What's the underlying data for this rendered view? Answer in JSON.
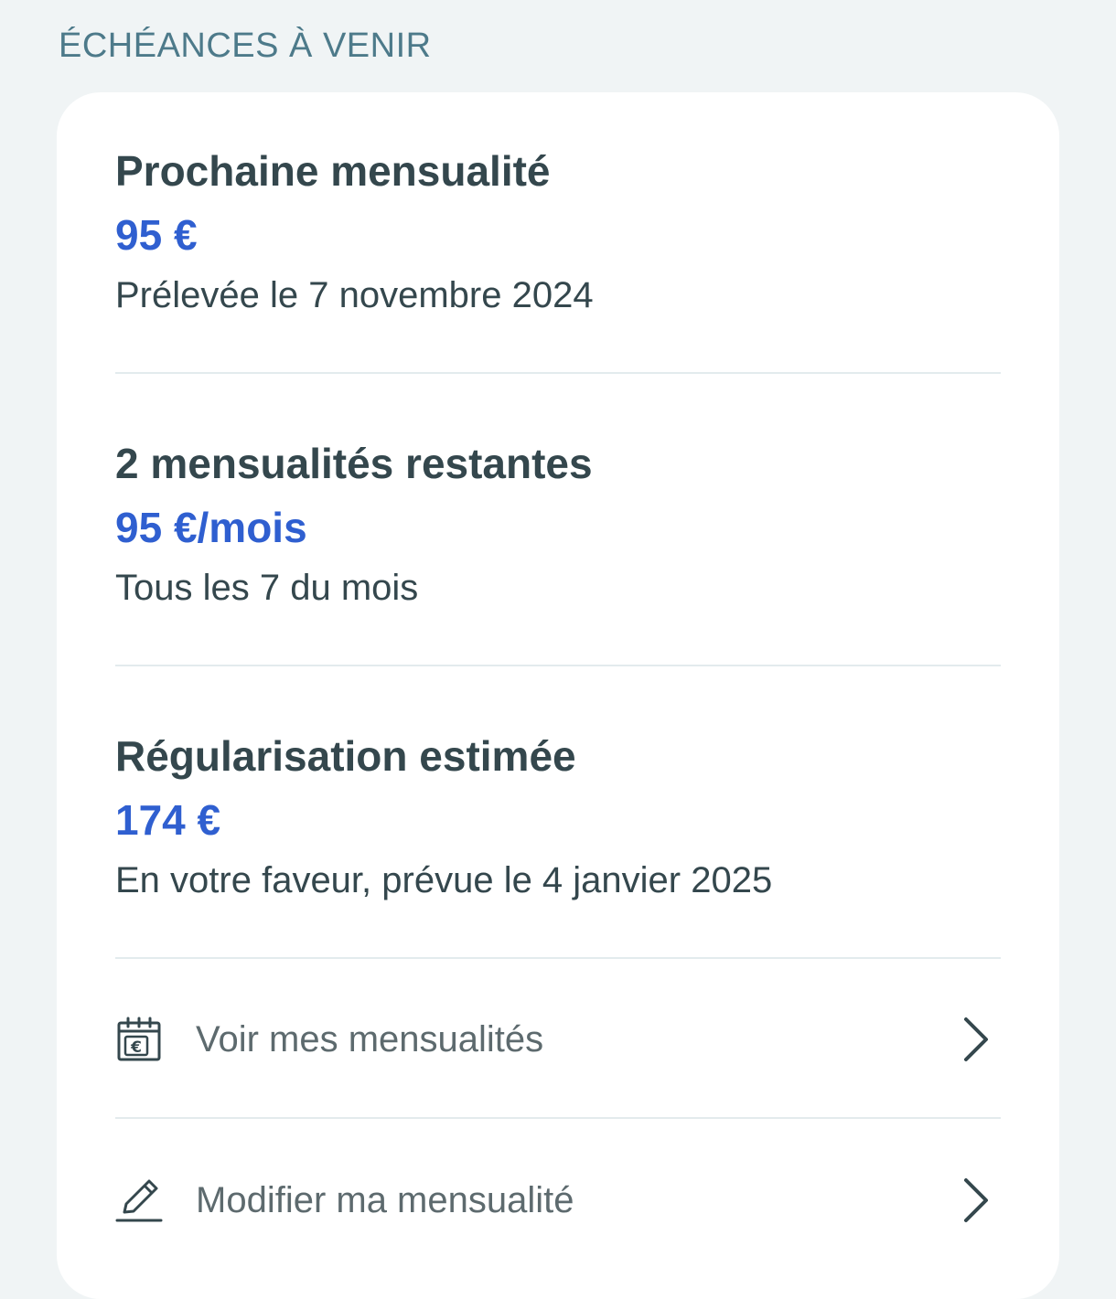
{
  "section": {
    "title": "ÉCHÉANCES À VENIR"
  },
  "card": {
    "next_payment": {
      "title": "Prochaine mensualité",
      "amount": "95 €",
      "note": "Prélevée le 7 novembre 2024"
    },
    "remaining": {
      "title": "2 mensualités restantes",
      "amount": "95 €/mois",
      "note": "Tous les 7 du mois"
    },
    "regularisation": {
      "title": "Régularisation estimée",
      "amount": "174 €",
      "note": "En votre faveur, prévue le 4 janvier 2025"
    },
    "actions": [
      {
        "label": "Voir mes mensualités",
        "icon": "calendar-euro-icon"
      },
      {
        "label": "Modifier ma mensualité",
        "icon": "pencil-icon"
      }
    ]
  },
  "colors": {
    "accent": "#2f5fd0",
    "text": "#34474d",
    "section_title": "#4d7a8a",
    "background": "#f0f4f5"
  }
}
